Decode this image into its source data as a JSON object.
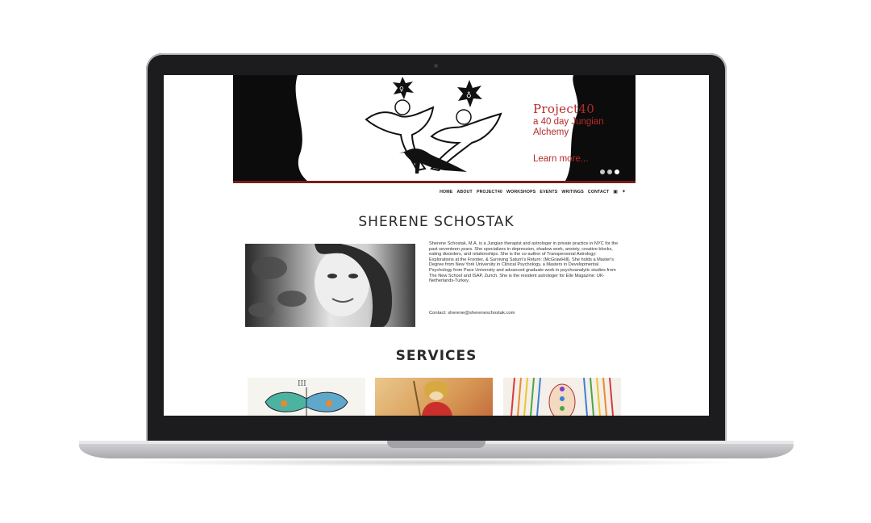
{
  "hero": {
    "title": "Project40",
    "subtitle": "a 40 day Jungian Alchemy",
    "cta": "Learn more...",
    "slides": 3,
    "accent_color": "#b52a2a"
  },
  "nav": {
    "items": [
      "HOME",
      "ABOUT",
      "PROJECT40",
      "WORKSHOPS",
      "EVENTS",
      "WRITINGS",
      "CONTACT"
    ],
    "social": [
      "facebook-icon",
      "twitter-icon"
    ]
  },
  "profile": {
    "name": "SHERENE SCHOSTAK",
    "bio": "Sherene Schostak, M.A. is a Jungian therapist and astrologer in private practice in NYC for the past seventeen years. She specializes in depression, shadow work, anxiety, creative blocks, eating disorders, and relationships. She is the co-author of Transpersonal Astrology: Explorations at the Frontier, & Surviving Saturn's Return: (McGrawHill). She holds a Master's Degree from New York University in Clinical Psychology, a Masters in Developmental Psychology from Pace University and advanced graduate work in psychoanalytic studies from The New School and ISAP, Zurich. She is the resident astrologer for Elle Magazine: UK-Netherlands-Turkey.",
    "contact": "Contact: sherene@shereneschostak.com"
  },
  "services": {
    "heading": "SERVICES"
  }
}
